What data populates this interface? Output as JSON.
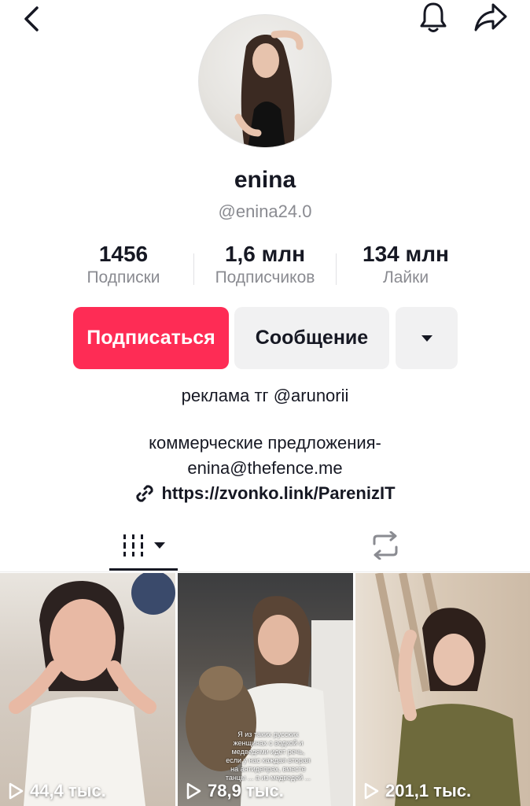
{
  "profile": {
    "display_name": "enina",
    "username": "@enina24.0"
  },
  "stats": {
    "following": {
      "value": "1456",
      "label": "Подписки"
    },
    "followers": {
      "value": "1,6 млн",
      "label": "Подписчиков"
    },
    "likes": {
      "value": "134 млн",
      "label": "Лайки"
    }
  },
  "actions": {
    "follow_label": "Подписаться",
    "message_label": "Сообщение"
  },
  "bio": {
    "line1": "реклама тг @arunorii",
    "line2": "коммерческие предложения-",
    "line3": "enina@thefence.me",
    "link": "https://zvonko.link/ParenizIT"
  },
  "videos": [
    {
      "views": "44,4 тыс."
    },
    {
      "views": "78,9 тыс.",
      "caption": "Я из таких русских женщинах с водкой и медведями идет речь, если у нас каждая вторая на антидепрах, вместе танцы ... а из медведей ..."
    },
    {
      "views": "201,1 тыс."
    }
  ],
  "colors": {
    "accent": "#fe2c55",
    "text_primary": "#161823",
    "text_secondary": "#8a8b91",
    "button_secondary": "#f1f1f2"
  },
  "icons": [
    "back-icon",
    "bell-icon",
    "share-icon",
    "dropdown-icon",
    "link-icon",
    "grid-icon",
    "repost-icon",
    "play-icon"
  ]
}
